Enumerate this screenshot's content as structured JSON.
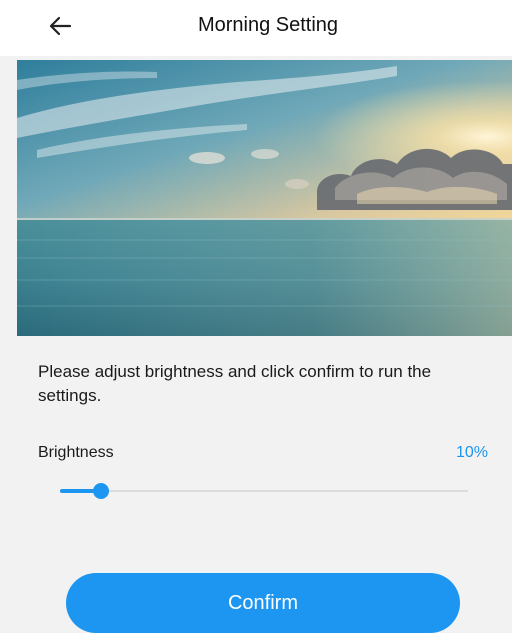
{
  "header": {
    "title": "Morning Setting",
    "back_icon": "arrow-left-icon"
  },
  "hero": {
    "scene": "sea-sunrise"
  },
  "content": {
    "instruction": "Please adjust brightness and click confirm to run the settings."
  },
  "brightness": {
    "label": "Brightness",
    "value_text": "10%",
    "value_percent": 10
  },
  "confirm": {
    "label": "Confirm"
  },
  "colors": {
    "accent": "#1c96f0",
    "background": "#f2f2f2"
  }
}
